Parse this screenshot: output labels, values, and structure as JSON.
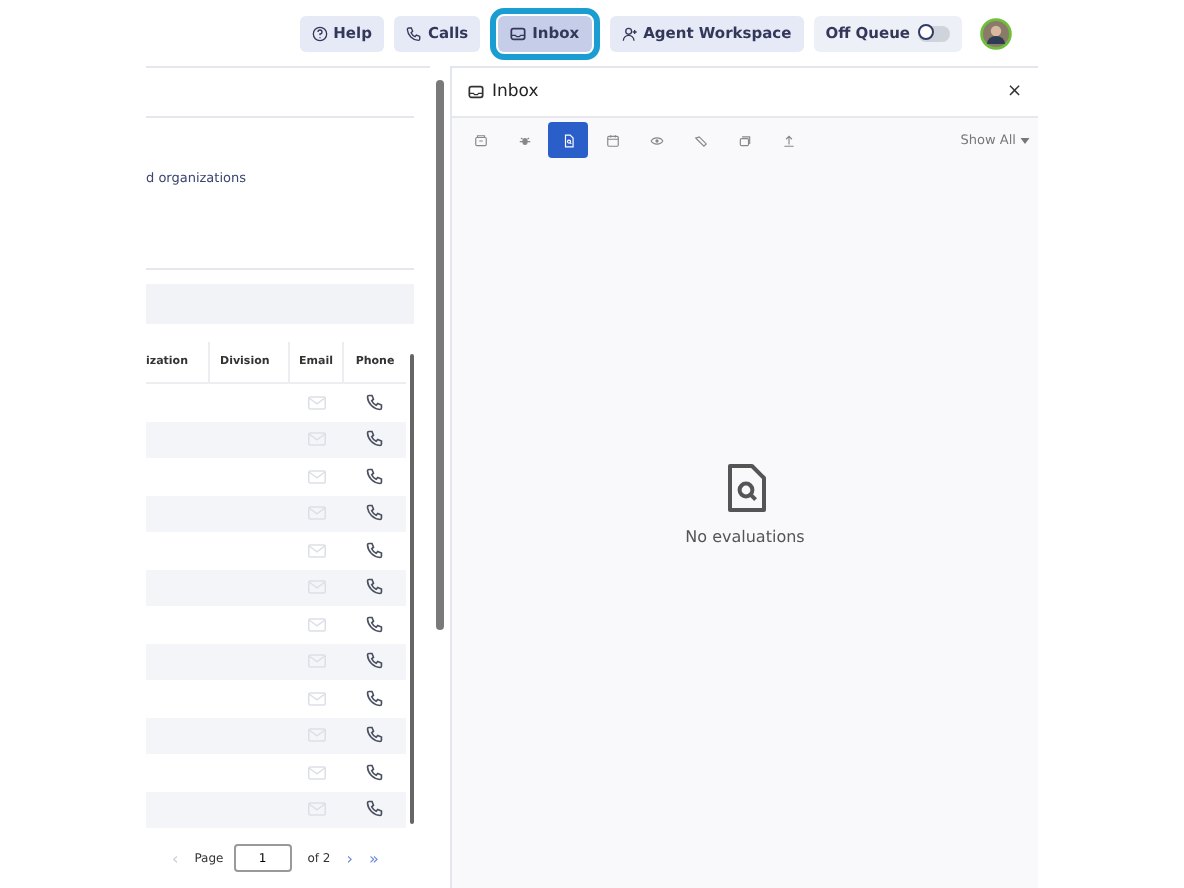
{
  "top_bar": {
    "buttons": [
      {
        "label": "Help",
        "kind": "help",
        "selected": false
      },
      {
        "label": "Calls",
        "kind": "calls",
        "selected": false
      },
      {
        "label": "Inbox",
        "kind": "inbox",
        "selected": true
      },
      {
        "label": "Agent Workspace",
        "kind": "agent",
        "selected": false
      }
    ],
    "queue_toggle": {
      "label": "Off Queue",
      "on": false
    }
  },
  "left_panel": {
    "description": "d organizations",
    "table": {
      "columns": [
        "ization",
        "Division",
        "Email",
        "Phone"
      ],
      "rows": [
        {
          "email_disabled": true
        },
        {
          "email_disabled": true
        },
        {
          "email_disabled": true
        },
        {
          "email_disabled": true
        },
        {
          "email_disabled": true
        },
        {
          "email_disabled": true
        },
        {
          "email_disabled": true
        },
        {
          "email_disabled": true
        },
        {
          "email_disabled": true
        },
        {
          "email_disabled": true
        },
        {
          "email_disabled": true
        },
        {
          "email_disabled": true
        }
      ]
    },
    "pagination": {
      "prev": "‹",
      "page_label": "Page",
      "page": "1",
      "of": "of 2",
      "next": "›",
      "last": "»"
    }
  },
  "inbox_panel": {
    "title": "Inbox",
    "close": "×",
    "filters": [
      {
        "kind": "archive",
        "selected": false
      },
      {
        "kind": "bug",
        "selected": false
      },
      {
        "kind": "evaluation",
        "selected": true
      },
      {
        "kind": "calendar",
        "selected": false
      },
      {
        "kind": "eye",
        "selected": false
      },
      {
        "kind": "tag",
        "selected": false
      },
      {
        "kind": "stack",
        "selected": false
      },
      {
        "kind": "upload",
        "selected": false
      }
    ],
    "show_all": "Show All",
    "empty_message": "No evaluations"
  }
}
